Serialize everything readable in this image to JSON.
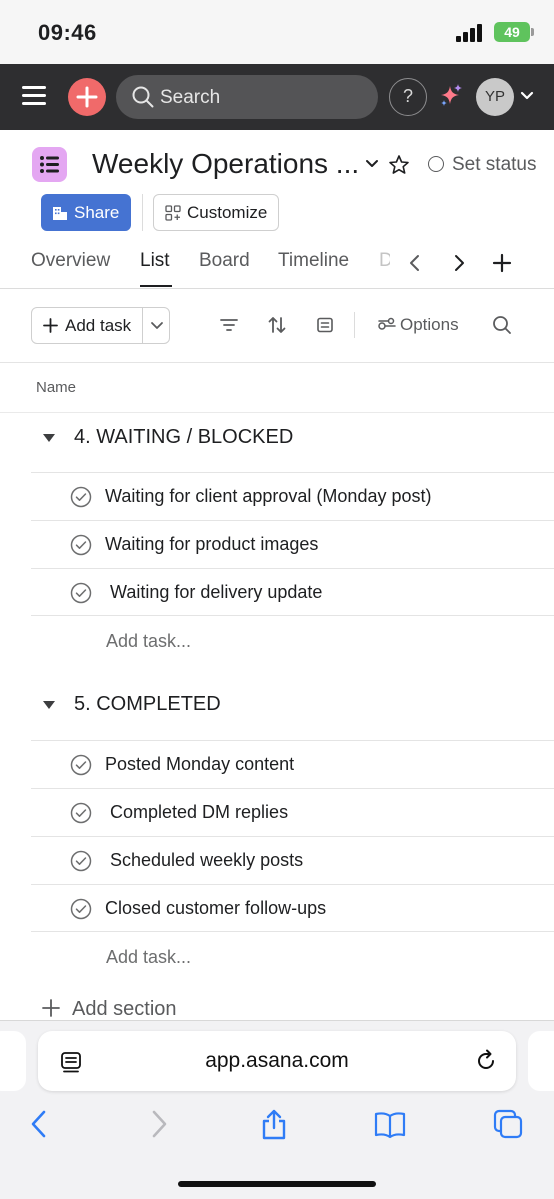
{
  "status_bar": {
    "time": "09:46",
    "battery": "49"
  },
  "topbar": {
    "search_placeholder": "Search",
    "help_label": "?",
    "avatar_initials": "YP",
    "colors": {
      "bar": "#2e2e30",
      "add": "#f06a6a"
    },
    "icons": [
      "hamburger-icon",
      "plus-icon",
      "search-icon",
      "help-icon",
      "sparkle-icon",
      "chevron-down-icon"
    ]
  },
  "project": {
    "title": "Weekly Operations ...",
    "set_status_label": "Set status",
    "share_label": "Share",
    "customize_label": "Customize",
    "icon_color": "#e4a7f2",
    "share_color": "#4573d2"
  },
  "tabs": [
    {
      "label": "Overview",
      "active": false
    },
    {
      "label": "List",
      "active": true
    },
    {
      "label": "Board",
      "active": false
    },
    {
      "label": "Timeline",
      "active": false
    },
    {
      "label": "D",
      "active": false
    }
  ],
  "toolbar": {
    "add_task_label": "Add task",
    "options_label": "Options",
    "icons": [
      "filter-icon",
      "sort-icon",
      "group-icon",
      "options-icon",
      "search-icon"
    ]
  },
  "list": {
    "column_name": "Name",
    "sections": [
      {
        "title": "4. WAITING / BLOCKED",
        "tasks": [
          "Waiting for client approval (Monday post)",
          "Waiting for product images",
          " Waiting for delivery update"
        ],
        "add_task_label": "Add task..."
      },
      {
        "title": "5. COMPLETED",
        "tasks": [
          "Posted Monday content",
          " Completed DM replies",
          " Scheduled weekly posts",
          "Closed customer follow-ups"
        ],
        "add_task_label": "Add task..."
      }
    ],
    "add_section_label": "Add section"
  },
  "browser": {
    "url": "app.asana.com",
    "icons": [
      "reader-icon",
      "reload-icon",
      "back-icon",
      "forward-icon",
      "share-icon",
      "bookmarks-icon",
      "tabs-icon"
    ]
  }
}
